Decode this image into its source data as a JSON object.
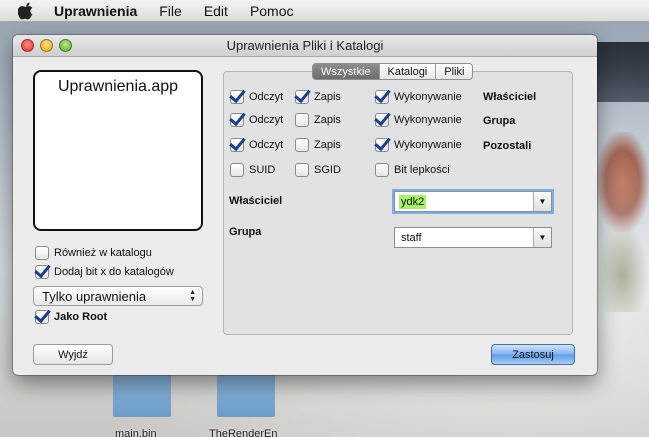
{
  "menubar": {
    "app_name": "Uprawnienia",
    "items": [
      "File",
      "Edit",
      "Pomoc"
    ]
  },
  "desktop": {
    "icons": [
      {
        "label": "main.bin"
      },
      {
        "label": "TheRenderEn"
      }
    ]
  },
  "window": {
    "title": "Uprawnienia Pliki i Katalogi",
    "app_box_label": "Uprawnienia.app",
    "options": {
      "rowniez_w_katalogu": {
        "label": "Również w katalogu",
        "checked": false
      },
      "dodaj_bit_x": {
        "label": "Dodaj bit x do katalogów",
        "checked": true
      },
      "jako_root": {
        "label": "Jako Root",
        "checked": true
      }
    },
    "mode_popup": {
      "value": "Tylko uprawnienia",
      "arrows": "▲▼"
    },
    "quit_button": "Wyjdź",
    "apply_button": "Zastosuj",
    "tabs": [
      {
        "label": "Wszystkie",
        "active": true
      },
      {
        "label": "Katalogi",
        "active": false
      },
      {
        "label": "Pliki",
        "active": false
      }
    ],
    "permissions": {
      "rows": [
        {
          "role": "Właściciel",
          "read": {
            "label": "Odczyt",
            "checked": true
          },
          "write": {
            "label": "Zapis",
            "checked": true
          },
          "exec": {
            "label": "Wykonywanie",
            "checked": true
          }
        },
        {
          "role": "Grupa",
          "read": {
            "label": "Odczyt",
            "checked": true
          },
          "write": {
            "label": "Zapis",
            "checked": false
          },
          "exec": {
            "label": "Wykonywanie",
            "checked": true
          }
        },
        {
          "role": "Pozostali",
          "read": {
            "label": "Odczyt",
            "checked": true
          },
          "write": {
            "label": "Zapis",
            "checked": false
          },
          "exec": {
            "label": "Wykonywanie",
            "checked": true
          }
        }
      ],
      "special": {
        "suid": {
          "label": "SUID",
          "checked": false
        },
        "sgid": {
          "label": "SGID",
          "checked": false
        },
        "sticky": {
          "label": "Bit lepkości",
          "checked": false
        }
      }
    },
    "owner": {
      "label": "Właściciel",
      "value": "ydk2"
    },
    "group": {
      "label": "Grupa",
      "value": "staff"
    }
  }
}
